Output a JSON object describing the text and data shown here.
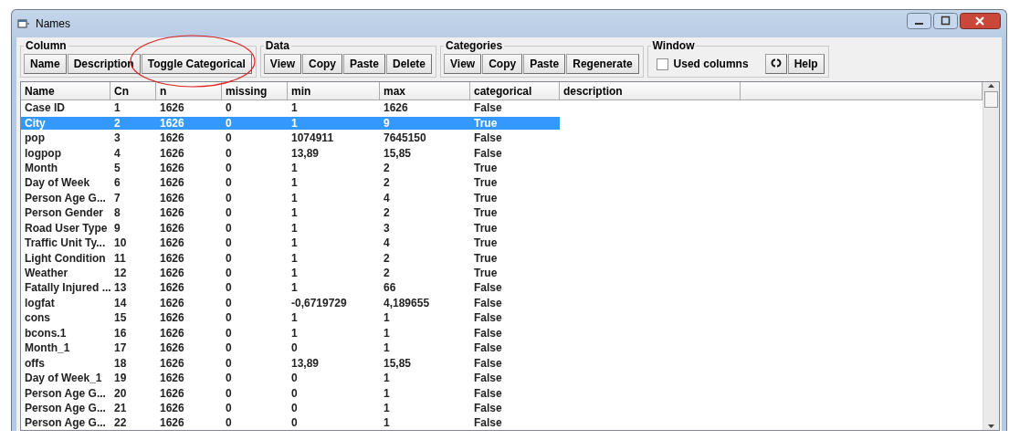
{
  "window": {
    "title": "Names"
  },
  "toolbar": [
    {
      "label": "Column",
      "items": [
        {
          "kind": "button",
          "label": "Name"
        },
        {
          "kind": "button",
          "label": "Description"
        },
        {
          "kind": "button",
          "label": "Toggle Categorical",
          "annotated": true
        }
      ]
    },
    {
      "label": "Data",
      "items": [
        {
          "kind": "button",
          "label": "View"
        },
        {
          "kind": "button",
          "label": "Copy"
        },
        {
          "kind": "button",
          "label": "Paste"
        },
        {
          "kind": "button",
          "label": "Delete"
        }
      ]
    },
    {
      "label": "Categories",
      "items": [
        {
          "kind": "button",
          "label": "View"
        },
        {
          "kind": "button",
          "label": "Copy"
        },
        {
          "kind": "button",
          "label": "Paste"
        },
        {
          "kind": "button",
          "label": "Regenerate"
        }
      ]
    },
    {
      "label": "Window",
      "items": [
        {
          "kind": "checkbox",
          "label": "Used columns",
          "checked": false
        },
        {
          "kind": "refresh"
        },
        {
          "kind": "button",
          "label": "Help"
        }
      ]
    }
  ],
  "table": {
    "columns": [
      "Name",
      "Cn",
      "n",
      "missing",
      "min",
      "max",
      "categorical",
      "description"
    ],
    "rows": [
      {
        "cells": [
          "Case ID",
          "1",
          "1626",
          "0",
          "1",
          "1626",
          "False"
        ],
        "selected": false
      },
      {
        "cells": [
          "City",
          "2",
          "1626",
          "0",
          "1",
          "9",
          "True"
        ],
        "selected": true
      },
      {
        "cells": [
          "pop",
          "3",
          "1626",
          "0",
          "1074911",
          "7645150",
          "False"
        ],
        "selected": false
      },
      {
        "cells": [
          "logpop",
          "4",
          "1626",
          "0",
          "13,89",
          "15,85",
          "False"
        ],
        "selected": false
      },
      {
        "cells": [
          "Month",
          "5",
          "1626",
          "0",
          "1",
          "2",
          "True"
        ],
        "selected": false
      },
      {
        "cells": [
          "Day of Week",
          "6",
          "1626",
          "0",
          "1",
          "2",
          "True"
        ],
        "selected": false
      },
      {
        "cells": [
          "Person Age G...",
          "7",
          "1626",
          "0",
          "1",
          "4",
          "True"
        ],
        "selected": false
      },
      {
        "cells": [
          "Person Gender",
          "8",
          "1626",
          "0",
          "1",
          "2",
          "True"
        ],
        "selected": false
      },
      {
        "cells": [
          "Road User Type",
          "9",
          "1626",
          "0",
          "1",
          "3",
          "True"
        ],
        "selected": false
      },
      {
        "cells": [
          "Traffic Unit Ty...",
          "10",
          "1626",
          "0",
          "1",
          "4",
          "True"
        ],
        "selected": false
      },
      {
        "cells": [
          "Light Condition",
          "11",
          "1626",
          "0",
          "1",
          "2",
          "True"
        ],
        "selected": false
      },
      {
        "cells": [
          "Weather",
          "12",
          "1626",
          "0",
          "1",
          "2",
          "True"
        ],
        "selected": false
      },
      {
        "cells": [
          "Fatally Injured ...",
          "13",
          "1626",
          "0",
          "1",
          "66",
          "False"
        ],
        "selected": false
      },
      {
        "cells": [
          "logfat",
          "14",
          "1626",
          "0",
          "-0,6719729",
          "4,189655",
          "False"
        ],
        "selected": false
      },
      {
        "cells": [
          "cons",
          "15",
          "1626",
          "0",
          "1",
          "1",
          "False"
        ],
        "selected": false
      },
      {
        "cells": [
          "bcons.1",
          "16",
          "1626",
          "0",
          "1",
          "1",
          "False"
        ],
        "selected": false
      },
      {
        "cells": [
          "Month_1",
          "17",
          "1626",
          "0",
          "0",
          "1",
          "False"
        ],
        "selected": false
      },
      {
        "cells": [
          "offs",
          "18",
          "1626",
          "0",
          "13,89",
          "15,85",
          "False"
        ],
        "selected": false
      },
      {
        "cells": [
          "Day of Week_1",
          "19",
          "1626",
          "0",
          "0",
          "1",
          "False"
        ],
        "selected": false
      },
      {
        "cells": [
          "Person Age G...",
          "20",
          "1626",
          "0",
          "0",
          "1",
          "False"
        ],
        "selected": false
      },
      {
        "cells": [
          "Person Age G...",
          "21",
          "1626",
          "0",
          "0",
          "1",
          "False"
        ],
        "selected": false
      },
      {
        "cells": [
          "Person Age G...",
          "22",
          "1626",
          "0",
          "0",
          "1",
          "False"
        ],
        "selected": false
      }
    ]
  }
}
